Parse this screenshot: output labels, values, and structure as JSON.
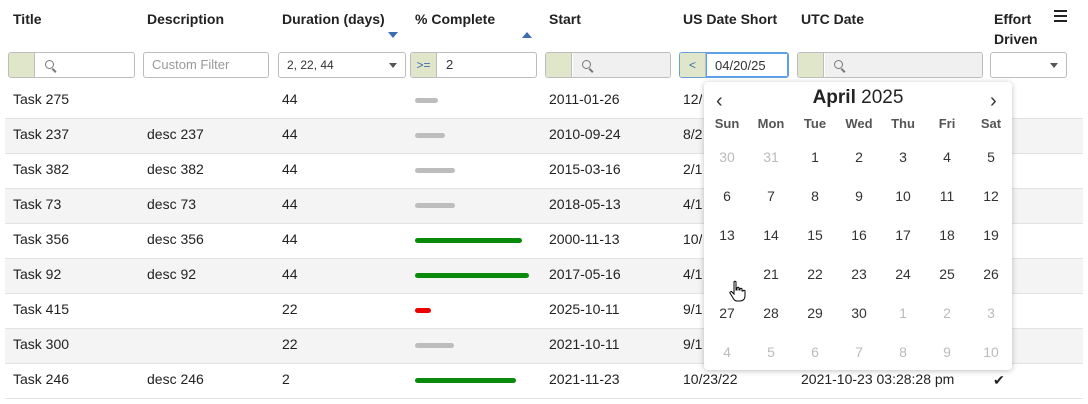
{
  "columns": {
    "title": "Title",
    "description": "Description",
    "duration": "Duration (days)",
    "complete": "% Complete",
    "start": "Start",
    "us_date_short": "US Date Short",
    "utc_date": "UTC Date",
    "effort_line1": "Effort",
    "effort_line2": "Driven"
  },
  "filters": {
    "description_placeholder": "Custom Filter",
    "duration_value": "2, 22, 44",
    "complete_operator": ">=",
    "complete_value": "2",
    "us_date_operator": "<",
    "us_date_value": "04/20/25"
  },
  "rows": [
    {
      "title": "Task 275",
      "description": "",
      "duration": "44",
      "complete": 20,
      "bar_color": "#bdbdbd",
      "start": "2011-01-26",
      "us_date": "12/",
      "utc": "",
      "effort": false
    },
    {
      "title": "Task 237",
      "description": "desc 237",
      "duration": "44",
      "complete": 26,
      "bar_color": "#bdbdbd",
      "start": "2010-09-24",
      "us_date": "8/2",
      "utc": "",
      "effort": false
    },
    {
      "title": "Task 382",
      "description": "desc 382",
      "duration": "44",
      "complete": 35,
      "bar_color": "#bdbdbd",
      "start": "2015-03-16",
      "us_date": "2/1",
      "utc": "",
      "effort": false
    },
    {
      "title": "Task 73",
      "description": "desc 73",
      "duration": "44",
      "complete": 35,
      "bar_color": "#bdbdbd",
      "start": "2018-05-13",
      "us_date": "4/1",
      "utc": "",
      "effort": false
    },
    {
      "title": "Task 356",
      "description": "desc 356",
      "duration": "44",
      "complete": 93,
      "bar_color": "#0a8a0a",
      "start": "2000-11-13",
      "us_date": "10/",
      "utc": "",
      "effort": false
    },
    {
      "title": "Task 92",
      "description": "desc 92",
      "duration": "44",
      "complete": 99,
      "bar_color": "#0a8a0a",
      "start": "2017-05-16",
      "us_date": "4/1",
      "utc": "",
      "effort": false
    },
    {
      "title": "Task 415",
      "description": "",
      "duration": "22",
      "complete": 14,
      "bar_color": "#ee0000",
      "start": "2025-10-11",
      "us_date": "9/1",
      "utc": "",
      "effort": false
    },
    {
      "title": "Task 300",
      "description": "",
      "duration": "22",
      "complete": 34,
      "bar_color": "#bdbdbd",
      "start": "2021-10-11",
      "us_date": "9/1",
      "utc": "",
      "effort": false
    },
    {
      "title": "Task 246",
      "description": "desc 246",
      "duration": "2",
      "complete": 88,
      "bar_color": "#0a8a0a",
      "start": "2021-11-23",
      "us_date": "10/23/22",
      "utc": "2021-10-23 03:28:28 pm",
      "effort": true
    }
  ],
  "calendar": {
    "month": "April",
    "year": "2025",
    "weekdays": [
      "Sun",
      "Mon",
      "Tue",
      "Wed",
      "Thu",
      "Fri",
      "Sat"
    ],
    "weeks": [
      [
        "30",
        "31",
        "1",
        "2",
        "3",
        "4",
        "5"
      ],
      [
        "6",
        "7",
        "8",
        "9",
        "10",
        "11",
        "12"
      ],
      [
        "13",
        "14",
        "15",
        "16",
        "17",
        "18",
        "19"
      ],
      [
        "20",
        "21",
        "22",
        "23",
        "24",
        "25",
        "26"
      ],
      [
        "27",
        "28",
        "29",
        "30",
        "1",
        "2",
        "3"
      ],
      [
        "4",
        "5",
        "6",
        "7",
        "8",
        "9",
        "10"
      ]
    ],
    "selected": "20"
  },
  "accent_color": "#569ff7"
}
